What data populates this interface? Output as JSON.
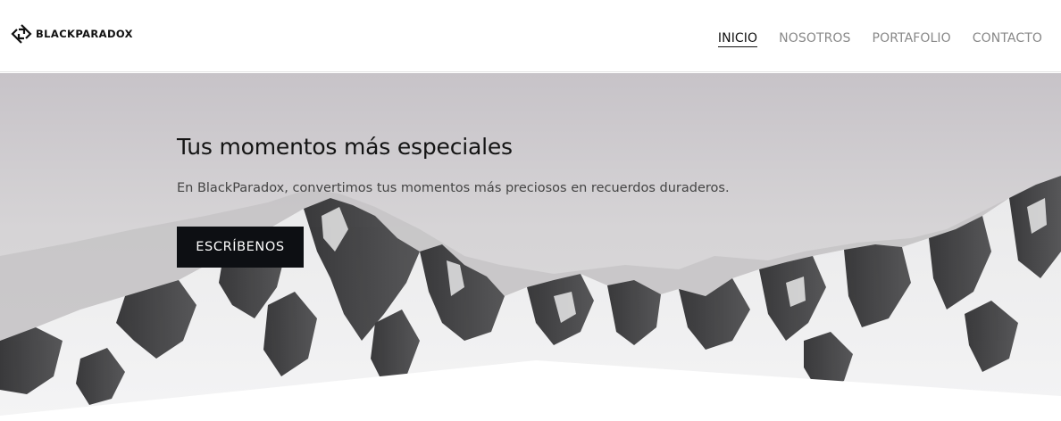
{
  "brand": {
    "logo_icon": "blackparadox-logo-icon",
    "name": "BLACKPARADOX"
  },
  "nav": {
    "items": [
      {
        "label": "INICIO",
        "active": true
      },
      {
        "label": "NOSOTROS",
        "active": false
      },
      {
        "label": "PORTAFOLIO",
        "active": false
      },
      {
        "label": "CONTACTO",
        "active": false
      }
    ]
  },
  "hero": {
    "title": "Tus momentos más especiales",
    "subtitle": "En BlackParadox, convertimos tus momentos más preciosos en recuerdos duraderos.",
    "cta_label": "ESCRÍBENOS",
    "background": "snowy-mountain-range"
  },
  "colors": {
    "text_dark": "#141414",
    "nav_inactive": "#888888",
    "button_bg": "#0d0f13",
    "button_text": "#ffffff",
    "sky": "#cfcdd0"
  }
}
